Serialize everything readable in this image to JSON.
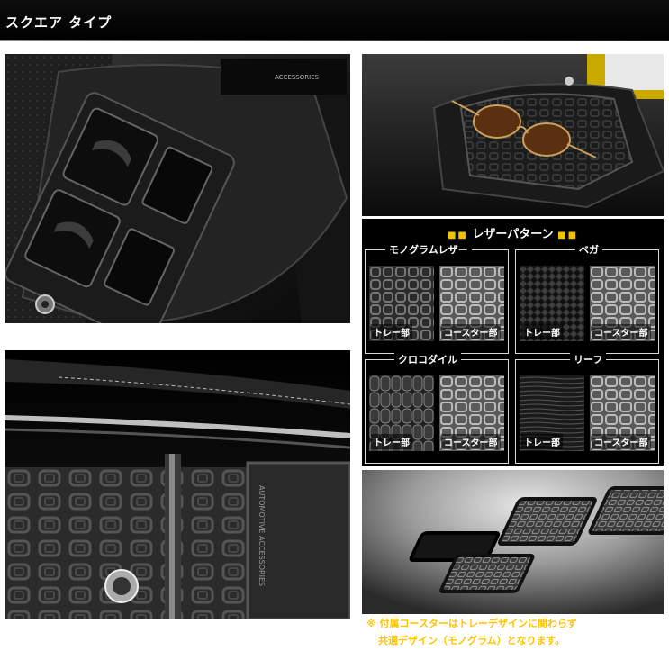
{
  "header": {
    "title": "スクエア タイプ"
  },
  "photos": {
    "console": {
      "emblem_text": "ACCESSORIES"
    },
    "tray_glasses": {},
    "closeup": {
      "emblem_text": "AUTOMOTIVE ACCESSORIES"
    }
  },
  "panel": {
    "title": "レザーパターン",
    "patterns": [
      {
        "name": "モノグラムレザー",
        "tray_label": "トレー部",
        "coaster_label": "コースター部"
      },
      {
        "name": "ベガ",
        "tray_label": "トレー部",
        "coaster_label": "コースター部"
      },
      {
        "name": "クロコダイル",
        "tray_label": "トレー部",
        "coaster_label": "コースター部"
      },
      {
        "name": "リーフ",
        "tray_label": "トレー部",
        "coaster_label": "コースター部"
      }
    ]
  },
  "note": {
    "line1": "※ 付属コースターはトレーデザインに関わらず",
    "line2": "共通デザイン（モノグラム）となります。"
  },
  "colors": {
    "accent": "#ffc400",
    "title_dots": "#f2c200"
  }
}
